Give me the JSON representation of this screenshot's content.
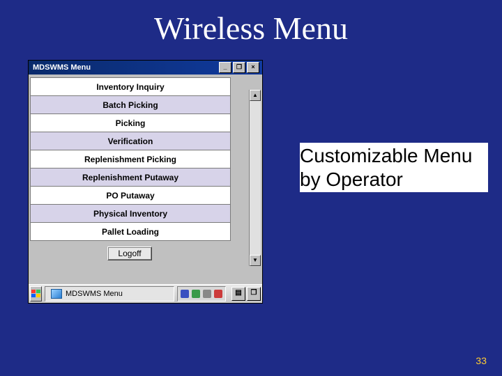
{
  "slide": {
    "title": "Wireless  Menu",
    "callout": "Customizable Menu by Operator",
    "page_number": "33"
  },
  "window": {
    "title": "MDSWMS Menu",
    "buttons": {
      "min": "_",
      "max": "❐",
      "close": "×"
    },
    "menu_items": [
      "Inventory Inquiry",
      "Batch Picking",
      "Picking",
      "Verification",
      "Replenishment Picking",
      "Replenishment Putaway",
      "PO Putaway",
      "Physical Inventory",
      "Pallet Loading"
    ],
    "logoff_label": "Logoff"
  },
  "taskbar": {
    "task_label": "MDSWMS Menu"
  }
}
